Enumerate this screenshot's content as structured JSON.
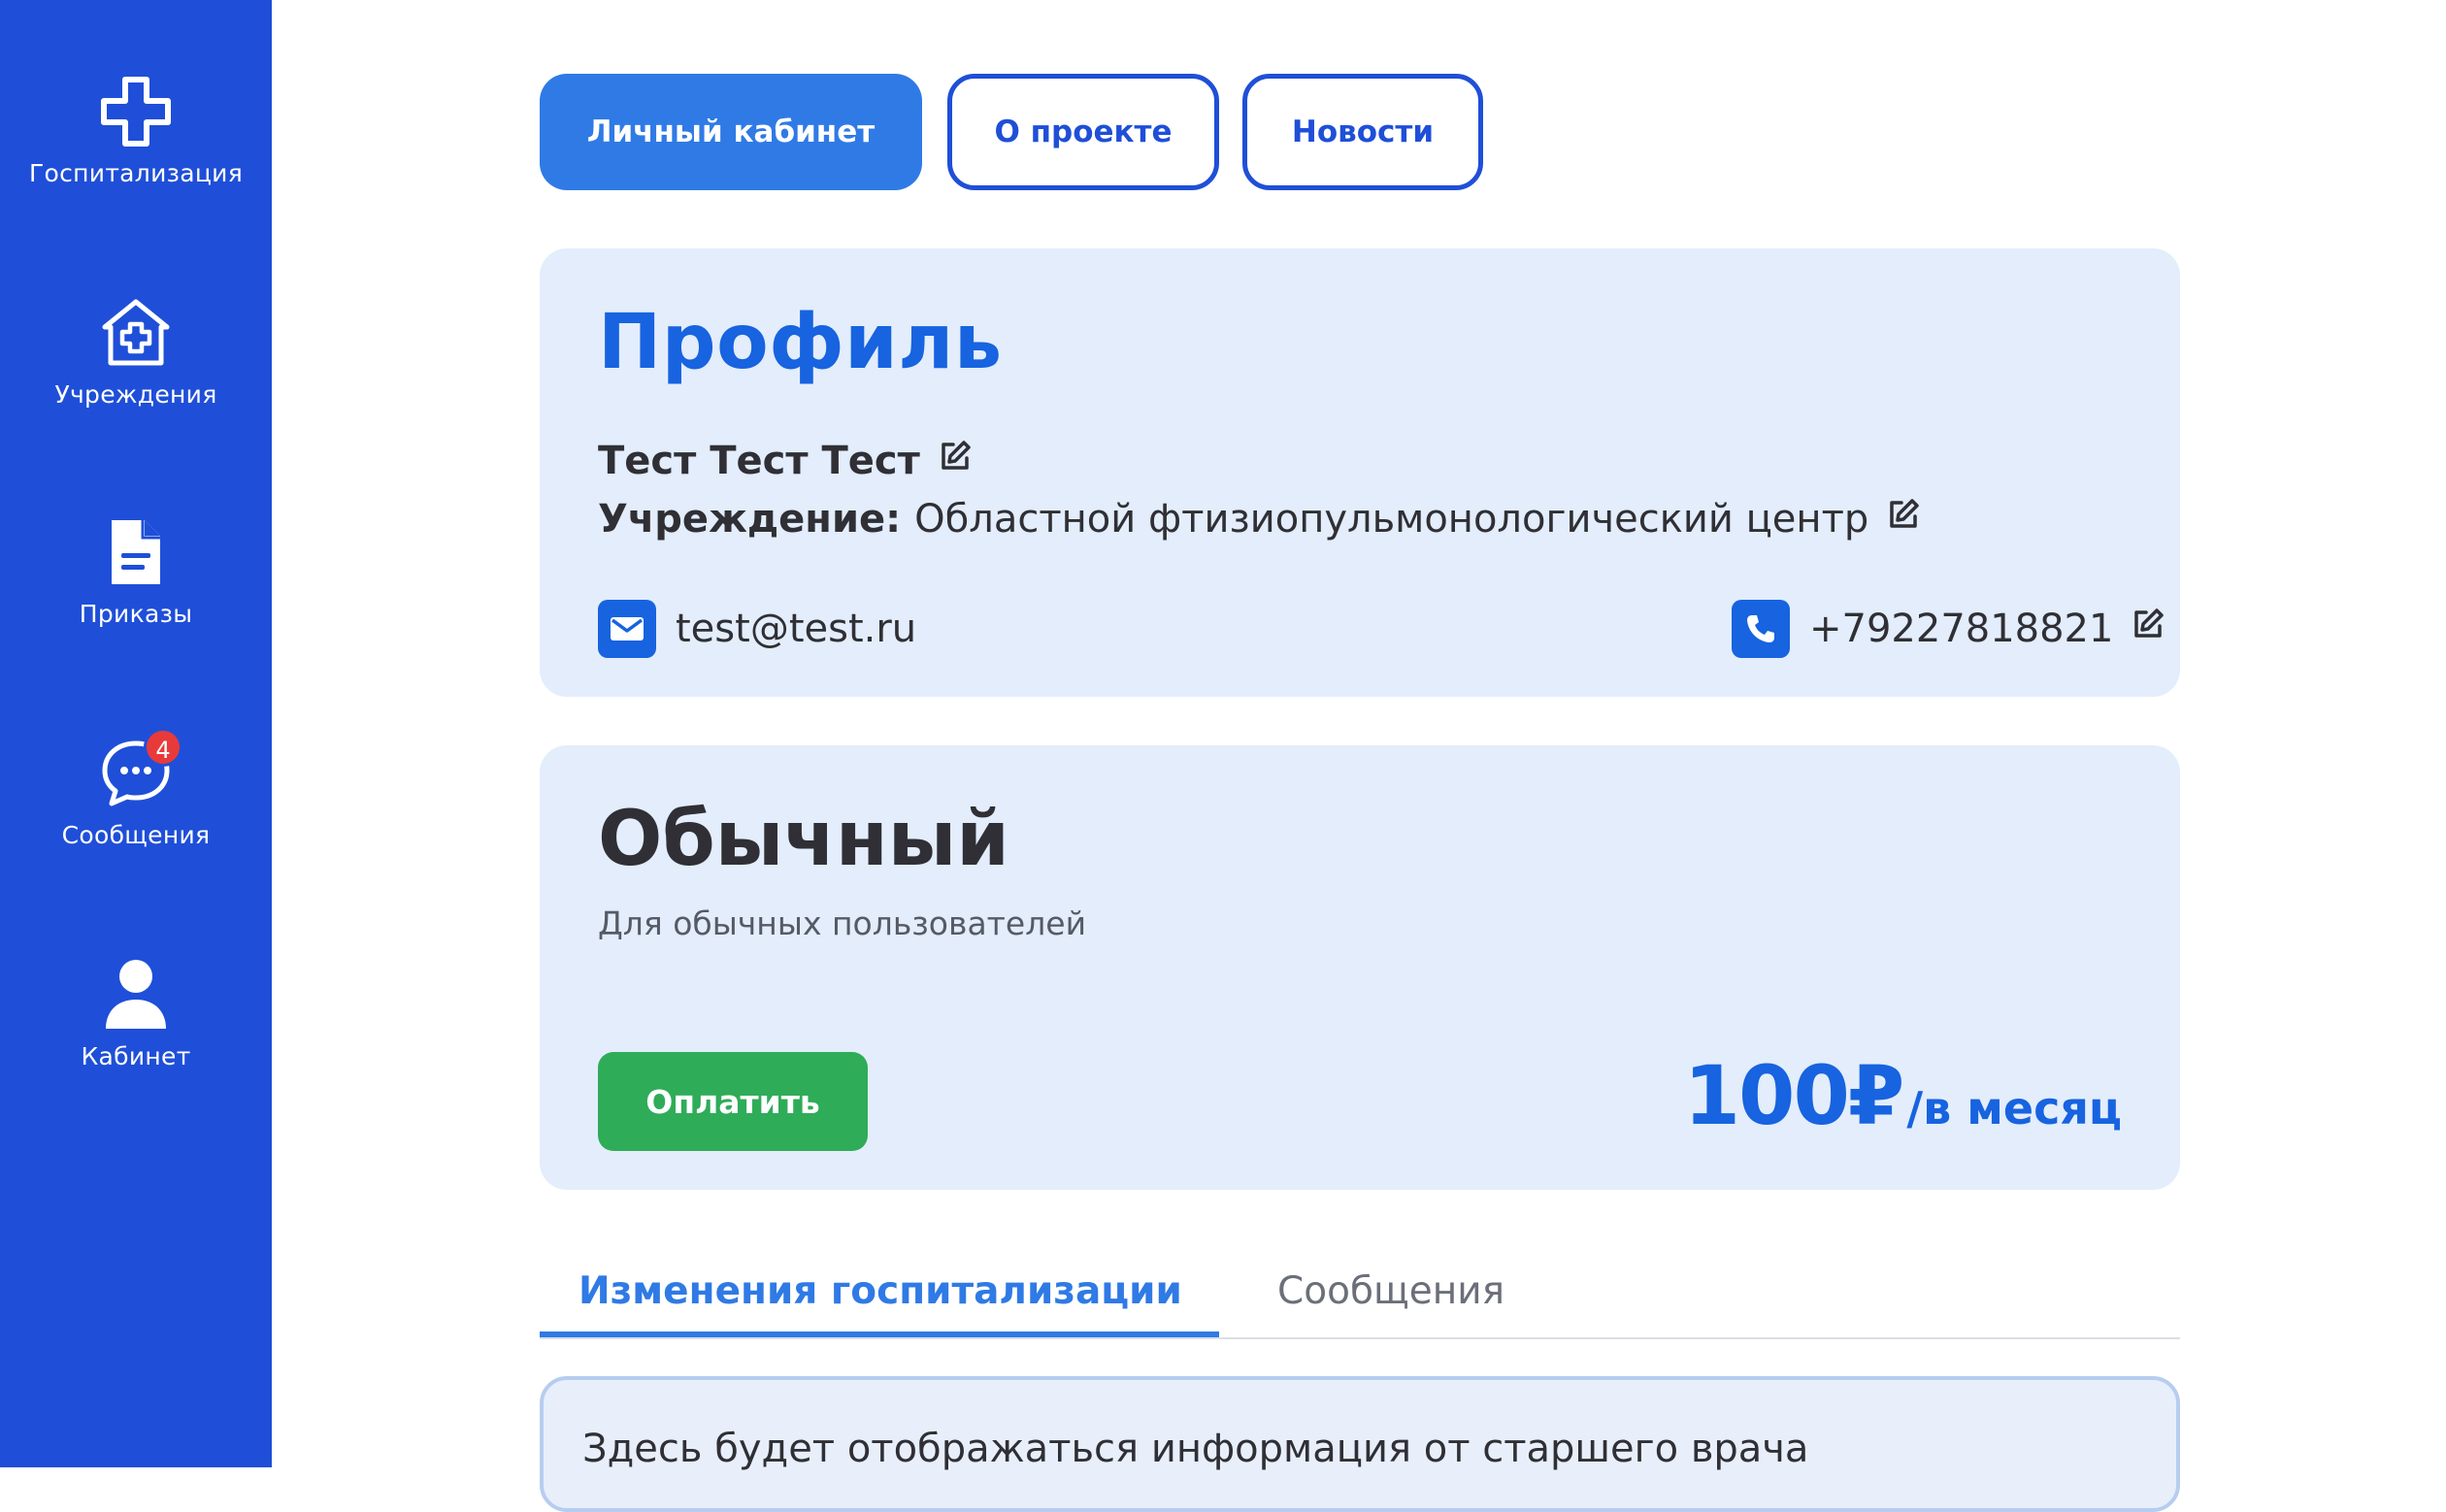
{
  "sidebar": {
    "items": [
      {
        "label": "Госпитализация",
        "icon": "medical-cross-icon"
      },
      {
        "label": "Учреждения",
        "icon": "hospital-house-icon"
      },
      {
        "label": "Приказы",
        "icon": "document-icon"
      },
      {
        "label": "Сообщения",
        "icon": "chat-bubble-icon",
        "badge": "4"
      },
      {
        "label": "Кабинет",
        "icon": "user-icon"
      }
    ]
  },
  "nav": {
    "personal": "Личный кабинет",
    "about": "О проекте",
    "news": "Новости"
  },
  "profile": {
    "title": "Профиль",
    "name": "Тест Тест Тест",
    "institution_label": "Учреждение:",
    "institution_value": "Областной фтизиопульмонологический центр",
    "email": "test@test.ru",
    "phone": "+79227818821"
  },
  "plan": {
    "title": "Обычный",
    "subtitle": "Для обычных пользователей",
    "pay_label": "Оплатить",
    "price": "100₽",
    "period": "/в месяц"
  },
  "tabs": {
    "active": "Изменения госпитализации",
    "inactive": "Сообщения"
  },
  "info": {
    "text": "Здесь будет отображаться информация от старшего врача"
  },
  "colors": {
    "sidebar": "#1f4fd8",
    "accent": "#1763e0",
    "nav_active": "#2f7ae5",
    "card_bg": "#e3edfb",
    "pay_green": "#2fac58",
    "badge_red": "#e83a3a"
  }
}
